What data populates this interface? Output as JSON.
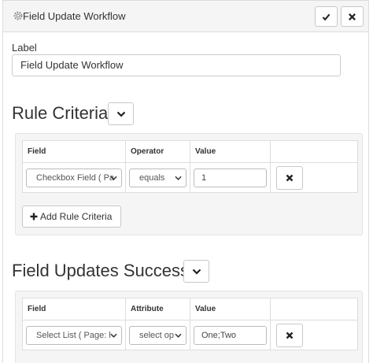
{
  "header": {
    "title": "Field Update Workflow",
    "icon": "gear-icon",
    "confirm_icon": "check-icon",
    "close_icon": "close-icon"
  },
  "label_field": {
    "label": "Label",
    "value": "Field Update Workflow"
  },
  "rule_criteria": {
    "title": "Rule Criteria",
    "columns": [
      "Field",
      "Operator",
      "Value",
      ""
    ],
    "rows": [
      {
        "field": "Checkbox Field ( Pa",
        "operator": "equals",
        "value": "1"
      }
    ],
    "add_button_label": "Add Rule Criteria"
  },
  "field_updates_success": {
    "title": "Field Updates Success",
    "columns": [
      "Field",
      "Attribute",
      "Value",
      ""
    ],
    "rows": [
      {
        "field": "Select List ( Page: l",
        "attribute": "select op",
        "value": "One;Two"
      }
    ]
  },
  "colors": {
    "header_bg": "#f5f5f5",
    "well_bg": "#f5f5f5",
    "border": "#dcdcdc"
  }
}
